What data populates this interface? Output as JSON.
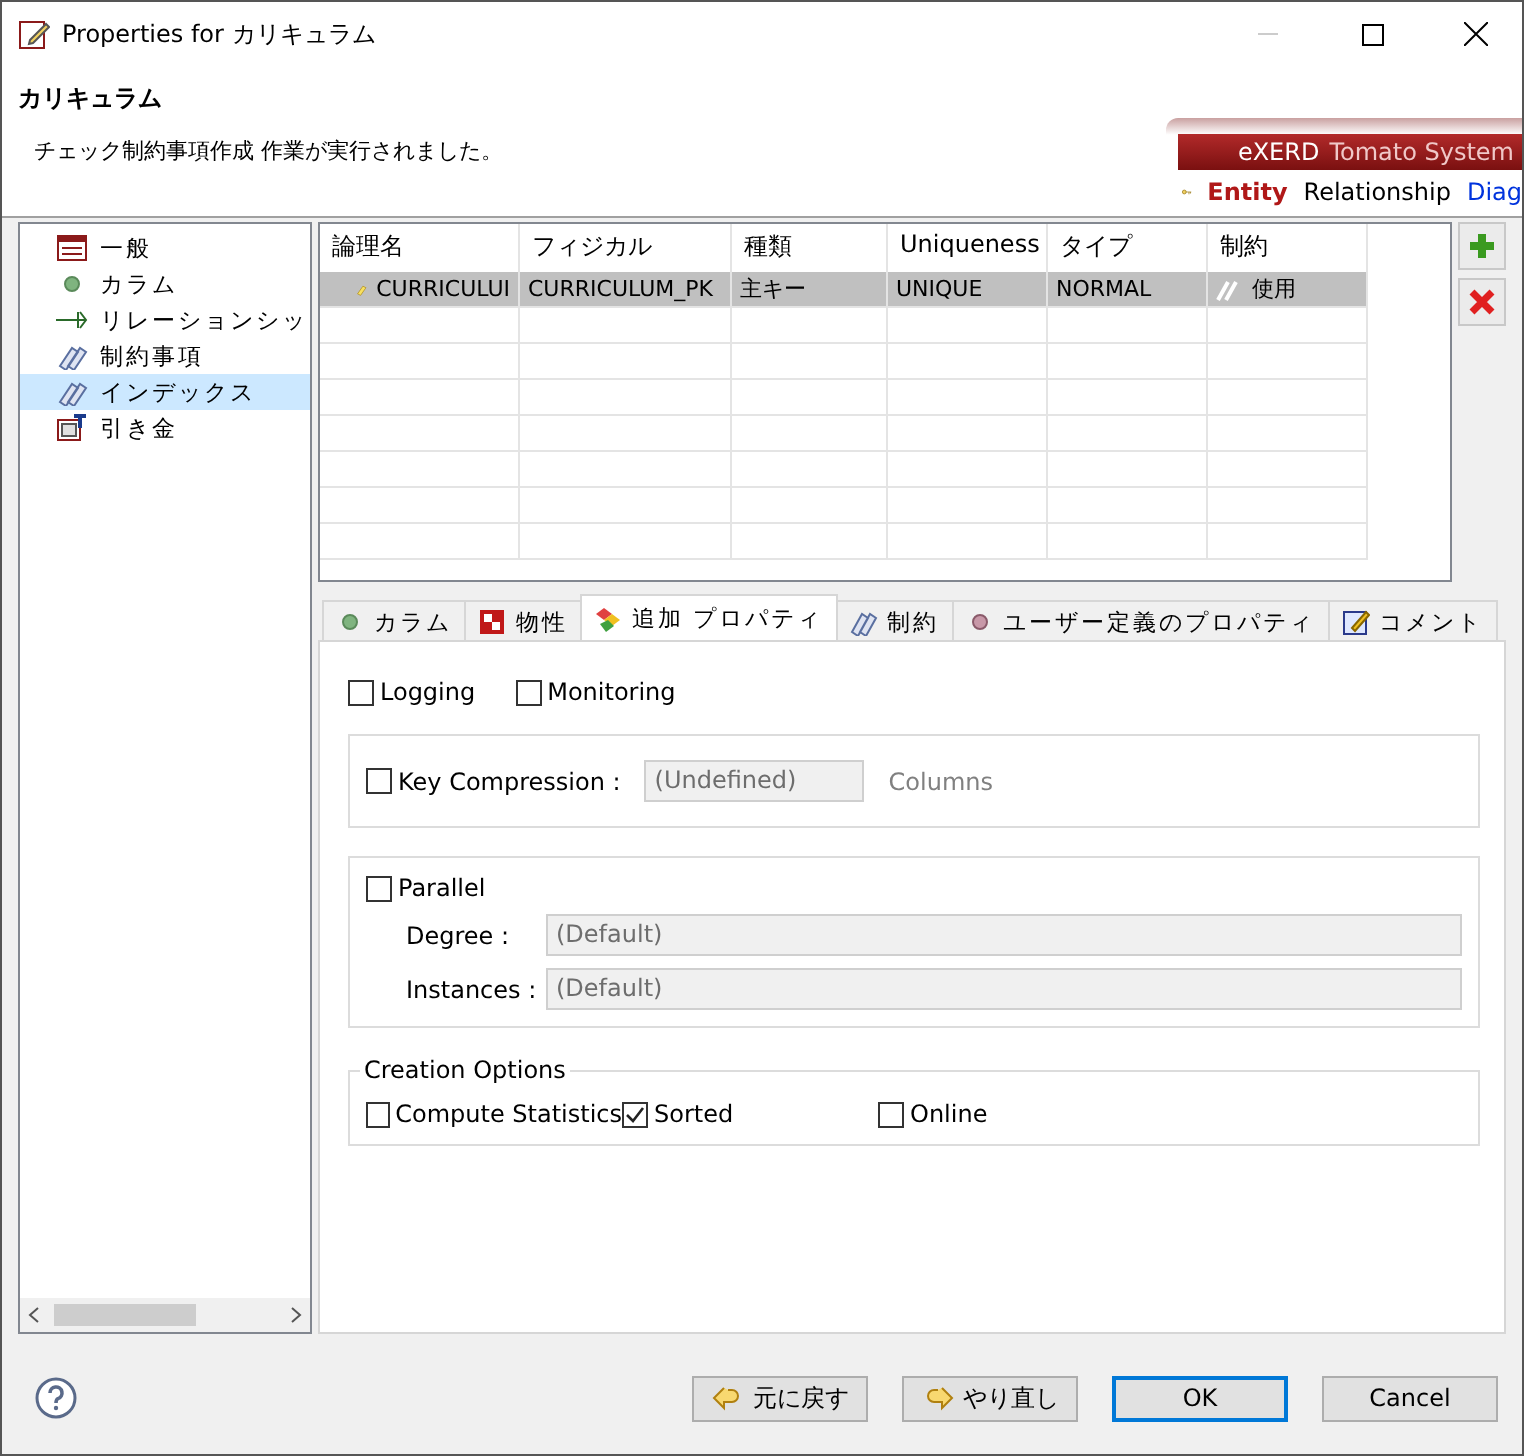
{
  "window": {
    "title": "Properties for カリキュラム"
  },
  "header": {
    "title": "カリキュラム",
    "message": "チェック制約事項作成 作業が実行されました。",
    "banner": {
      "product": "eXERD",
      "company": "Tomato System",
      "tabs": [
        {
          "label": "Entity",
          "kind": "tab",
          "selected": true
        },
        {
          "label": "Relationship",
          "kind": "tab",
          "selected": false
        },
        {
          "label": "Diag",
          "kind": "link",
          "selected": false
        }
      ]
    }
  },
  "sidebar": {
    "items": [
      {
        "label": "一般",
        "selected": false
      },
      {
        "label": "カラム",
        "selected": false
      },
      {
        "label": "リレーションシッ",
        "selected": false
      },
      {
        "label": "制約事項",
        "selected": false
      },
      {
        "label": "インデックス",
        "selected": true
      },
      {
        "label": "引き金",
        "selected": false
      }
    ]
  },
  "table": {
    "columns": [
      "論理名",
      "フィジカル",
      "種類",
      "Uniqueness",
      "タイプ",
      "制約"
    ],
    "rows": [
      {
        "cells": [
          "CURRICULUI",
          "CURRICULUM_PK",
          "主キー",
          "UNIQUE",
          "NORMAL",
          "使用"
        ],
        "selected": true
      }
    ]
  },
  "tabs": [
    {
      "label": "カラム",
      "selected": false
    },
    {
      "label": "物性",
      "selected": false
    },
    {
      "label": "追加 プロパティ",
      "selected": true
    },
    {
      "label": "制約",
      "selected": false
    },
    {
      "label": "ユーザー定義のプロパティ",
      "selected": false
    },
    {
      "label": "コメント",
      "selected": false
    }
  ],
  "options": [
    {
      "label": "Logging",
      "checked": false
    },
    {
      "label": "Monitoring",
      "checked": false
    }
  ],
  "key_compression": {
    "label": "Key Compression :",
    "checked": false,
    "value": "(Undefined)",
    "disabled": true,
    "suffix": "Columns"
  },
  "parallel": {
    "label": "Parallel",
    "checked": false,
    "fields": [
      {
        "label": "Degree :",
        "value": "(Default)",
        "disabled": true
      },
      {
        "label": "Instances :",
        "value": "(Default)",
        "disabled": true
      }
    ]
  },
  "creation_options": {
    "title": "Creation Options",
    "options": [
      {
        "label": "Compute Statistics",
        "checked": false
      },
      {
        "label": "Sorted",
        "checked": true
      },
      {
        "label": "Online",
        "checked": false
      }
    ]
  },
  "footer": {
    "buttons": [
      {
        "label": "元に戻す",
        "default": false
      },
      {
        "label": "やり直し",
        "default": false
      },
      {
        "label": "OK",
        "default": true
      },
      {
        "label": "Cancel",
        "default": false
      }
    ]
  }
}
